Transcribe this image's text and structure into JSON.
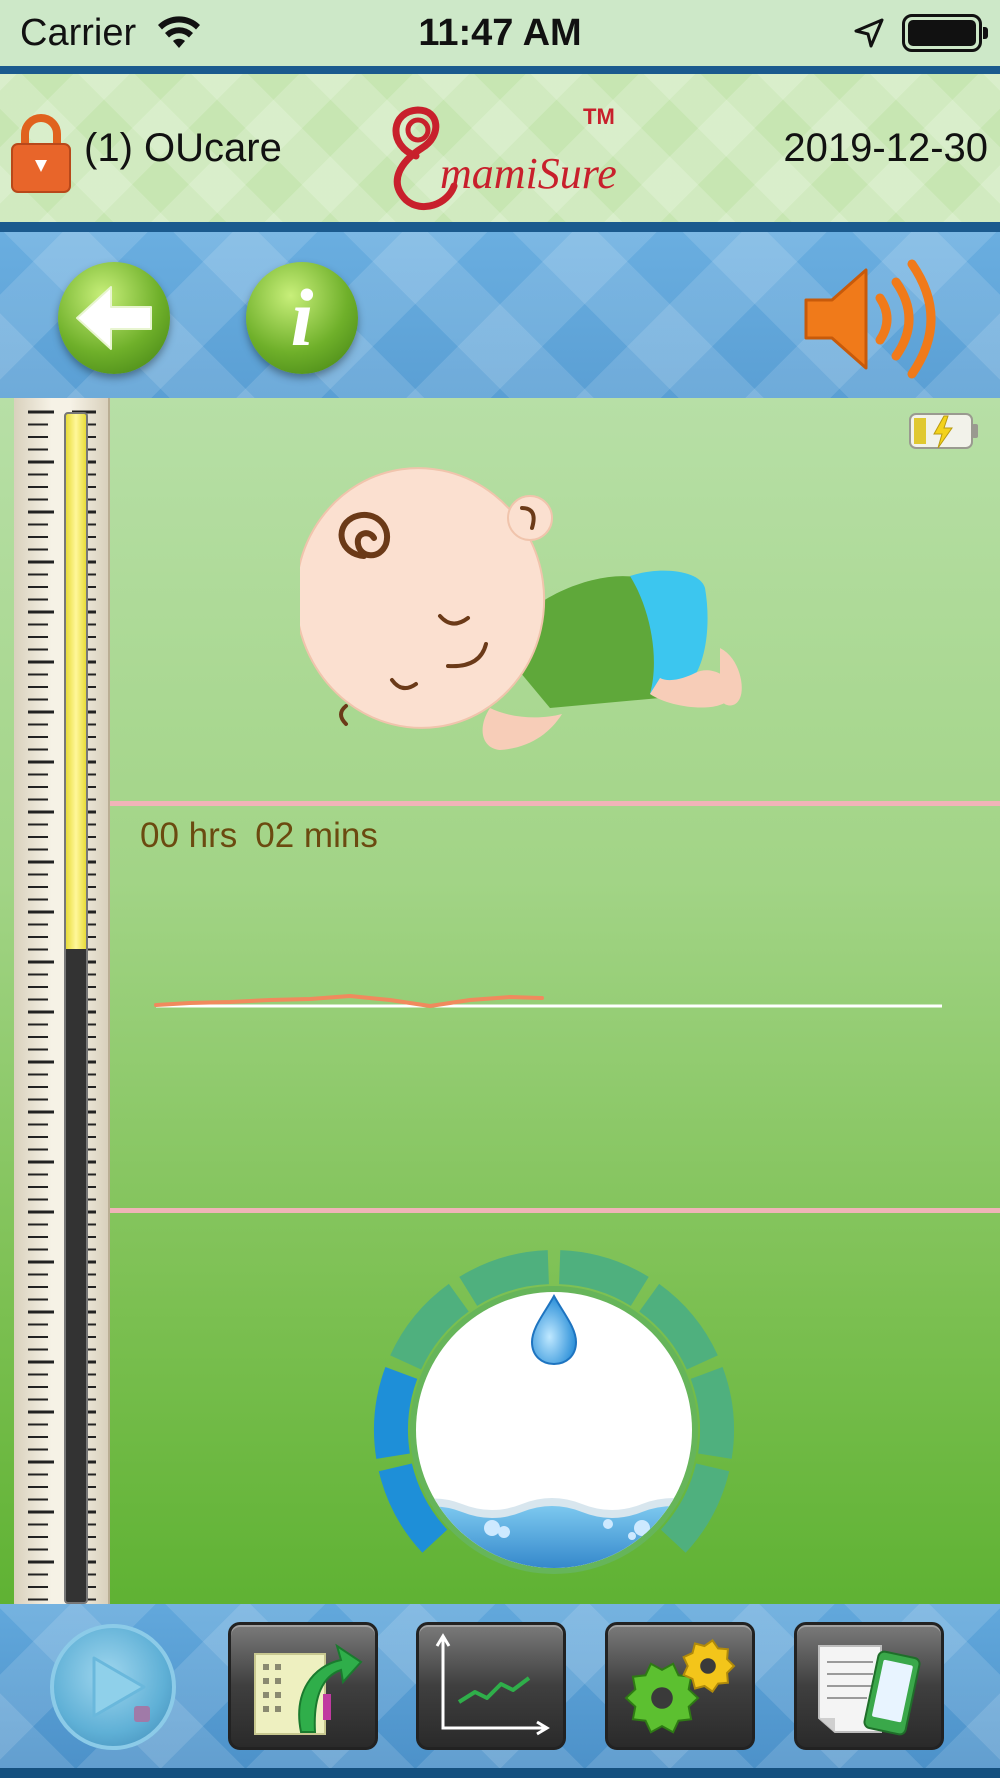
{
  "status_bar": {
    "carrier": "Carrier",
    "time": "11:47 AM"
  },
  "header": {
    "user_label": "(1) OUcare",
    "logo_text": "mamiSure",
    "trademark": "TM",
    "date": "2019-12-30"
  },
  "toolbar": {
    "icons": [
      "back-arrow-icon",
      "info-icon",
      "speaker-icon"
    ],
    "info_glyph": "i"
  },
  "monitor": {
    "duration_hours": "00 hrs",
    "duration_mins": "02 mins",
    "temperature_level_fraction": 0.45,
    "wetness_level_fraction": 0.25,
    "device_battery": "charging",
    "colors": {
      "signal_line": "#f08a5d",
      "baseline": "#ffffff",
      "divider": "#f0b4b8",
      "duration_text": "#6b4a10"
    }
  },
  "bottom_bar": {
    "icons": [
      "play-icon",
      "export-data-icon",
      "trend-chart-icon",
      "settings-gears-icon",
      "report-phone-icon"
    ]
  }
}
